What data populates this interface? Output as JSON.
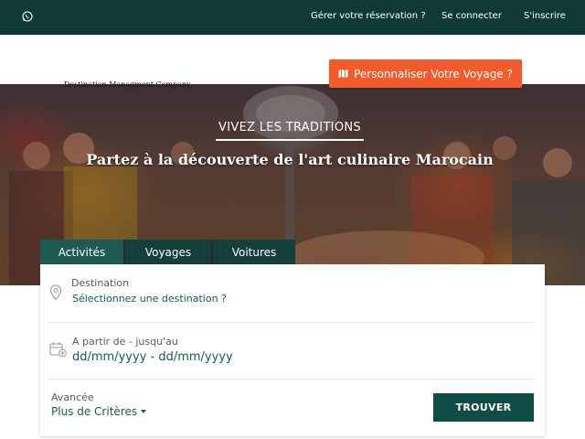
{
  "topbar": {
    "whatsapp_icon": "whatsapp-icon",
    "links": [
      {
        "label": "Gérer votre réservation ?"
      },
      {
        "label": "Se connecter"
      },
      {
        "label": "S'inscrire"
      }
    ]
  },
  "header": {
    "logo_subtitle": "Destination Managment Company",
    "cta_label": "Personnaliser Votre Voyage ?",
    "cta_icon": "map-icon"
  },
  "hero": {
    "eyebrow": "VIVEZ LES TRADITIONS",
    "headline": "Partez à la découverte de l'art culinaire Marocain"
  },
  "tabs": [
    {
      "label": "Activités",
      "active": true
    },
    {
      "label": "Voyages",
      "active": false
    },
    {
      "label": "Voitures",
      "active": false
    }
  ],
  "search": {
    "destination_label": "Destination",
    "destination_placeholder": "Sélectionnez une destination ?",
    "destination_icon": "location-pin-icon",
    "dates_label": "A partir de - jusqu'au",
    "dates_value": "dd/mm/yyyy - dd/mm/yyyy",
    "dates_icon": "calendar-add-icon",
    "advanced_label": "Avancée",
    "criteria_label": "Plus de Critères",
    "submit_label": "TROUVER"
  },
  "colors": {
    "topbar": "#0f3a35",
    "accent": "#f35b2c",
    "primary": "#114d47"
  }
}
